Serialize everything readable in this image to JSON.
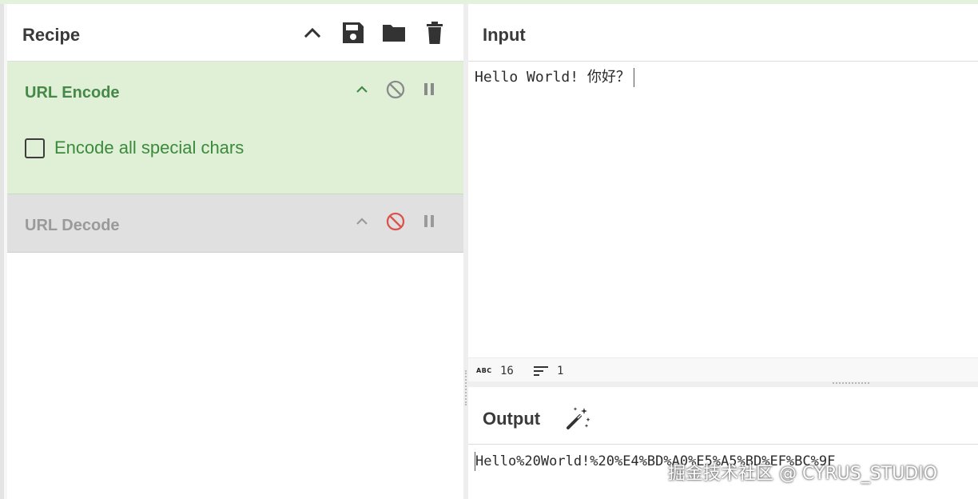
{
  "colors": {
    "accent_green": "#468847",
    "encode_bg": "#dff0d7",
    "decode_bg": "#e0e0e0",
    "disabled_red": "#d9534f"
  },
  "recipe": {
    "title": "Recipe",
    "header_icons": [
      "chevron-up-icon",
      "save-icon",
      "folder-icon",
      "trash-icon"
    ],
    "operations": [
      {
        "name": "URL Encode",
        "state": "active",
        "options": [
          {
            "label": "Encode all special chars",
            "checked": false
          }
        ],
        "icons": [
          "chevron-up-icon",
          "disable-icon",
          "breakpoint-icon"
        ]
      },
      {
        "name": "URL Decode",
        "state": "disabled",
        "icons": [
          "chevron-up-icon",
          "disable-icon",
          "breakpoint-icon"
        ]
      }
    ]
  },
  "input": {
    "title": "Input",
    "text_ascii": "Hello World! ",
    "text_cjk": "你好？",
    "stats": {
      "chars_icon": "abc-icon",
      "chars": "16",
      "lines_icon": "lines-icon",
      "lines": "1"
    }
  },
  "output": {
    "title": "Output",
    "magic_icon": "magic-wand-icon",
    "text": "Hello%20World!%20%E4%BD%A0%E5%A5%BD%EF%BC%9F"
  },
  "watermark": "掘金技术社区 @ CYRUS_STUDIO"
}
